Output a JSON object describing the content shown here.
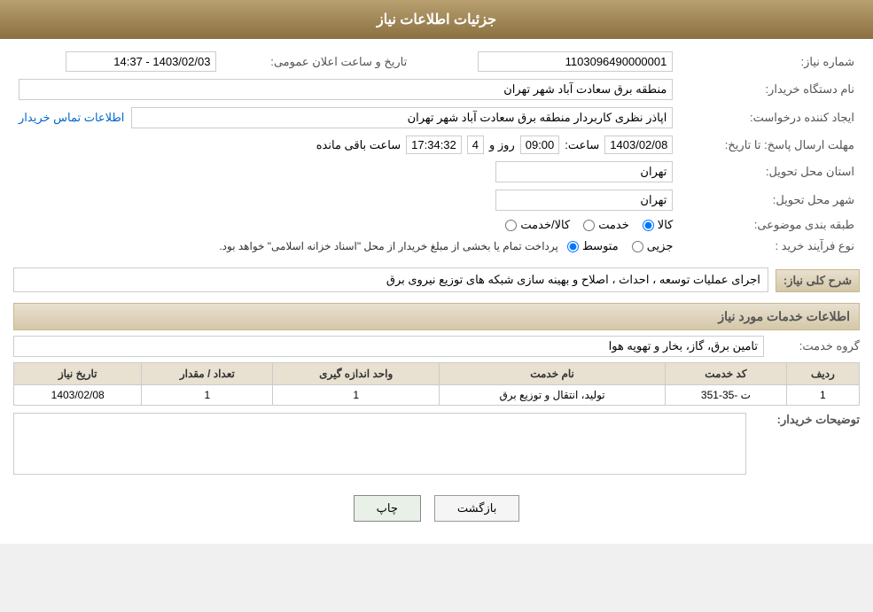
{
  "header": {
    "title": "جزئیات اطلاعات نیاز"
  },
  "fields": {
    "shomareNiaz_label": "شماره نیاز:",
    "shomareNiaz_value": "1103096490000001",
    "namedastgah_label": "نام دستگاه خریدار:",
    "namedastgah_value": "منطقه برق سعادت آباد شهر تهران",
    "eijadkonande_label": "ایجاد کننده درخواست:",
    "eijadkonande_value": "اپاذر نظری کاربردار منطقه برق سعادت آباد شهر تهران",
    "moohlat_label": "مهلت ارسال پاسخ: تا تاریخ:",
    "moohlat_date": "1403/02/08",
    "moohlat_saat_label": "ساعت:",
    "moohlat_saat_value": "09:00",
    "moohlat_rooz_label": "روز و",
    "moohlat_rooz_value": "4",
    "moohlat_remaining_label": "ساعت باقی مانده",
    "moohlat_remaining_value": "17:34:32",
    "ostan_label": "استان محل تحویل:",
    "ostan_value": "تهران",
    "shahr_label": "شهر محل تحویل:",
    "shahr_value": "تهران",
    "tabaghe_label": "طبقه بندی موضوعی:",
    "tabaghe_options": [
      "کالا",
      "خدمت",
      "کالا/خدمت"
    ],
    "tabaghe_selected": "کالا",
    "noeFarayand_label": "نوع فرآیند خرید :",
    "noeFarayand_options": [
      "جزیی",
      "متوسط"
    ],
    "noeFarayand_selected": "متوسط",
    "noeFarayand_note": "پرداخت تمام یا بخشی از مبلغ خریدار از محل \"اسناد خزانه اسلامی\" خواهد بود.",
    "taarikh_aalan_label": "تاریخ و ساعت اعلان عمومی:",
    "taarikh_aalan_value": "1403/02/03 - 14:37",
    "etelaaat_label": "اطلاعات تماس خریدار",
    "sharh_label": "شرح کلی نیاز:",
    "sharh_value": "اجرای عملیات توسعه ، احداث ، اصلاح و بهینه سازی شبکه های توزیع نیروی برق",
    "khadamat_section": "اطلاعات خدمات مورد نیاز",
    "goroh_label": "گروه خدمت:",
    "goroh_value": "تامین برق، گاز، بخار و تهویه هوا",
    "table_headers": [
      "ردیف",
      "کد خدمت",
      "نام خدمت",
      "واحد اندازه گیری",
      "تعداد / مقدار",
      "تاریخ نیاز"
    ],
    "table_rows": [
      {
        "radif": "1",
        "code": "ت -35-351",
        "name": "تولید، انتقال و توزیع برق",
        "vahed": "1",
        "tedad": "1",
        "taarikh": "1403/02/08"
      }
    ],
    "tousih_label": "توضیحات خریدار:",
    "tousih_value": "",
    "btn_back": "بازگشت",
    "btn_print": "چاپ"
  }
}
